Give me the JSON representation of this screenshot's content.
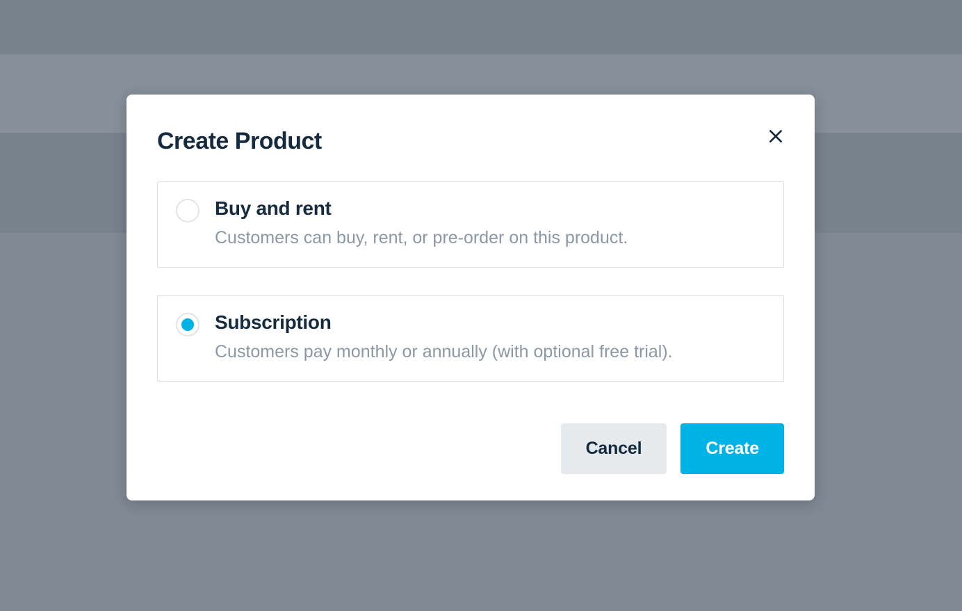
{
  "modal": {
    "title": "Create Product",
    "options": [
      {
        "title": "Buy and rent",
        "description": "Customers can buy, rent, or pre-order on this product.",
        "selected": false
      },
      {
        "title": "Subscription",
        "description": "Customers pay monthly or annually (with optional free trial).",
        "selected": true
      }
    ],
    "actions": {
      "cancel": "Cancel",
      "create": "Create"
    }
  },
  "colors": {
    "accent": "#00b3e6",
    "text_dark": "#142a3e",
    "text_muted": "#8b98a5"
  }
}
